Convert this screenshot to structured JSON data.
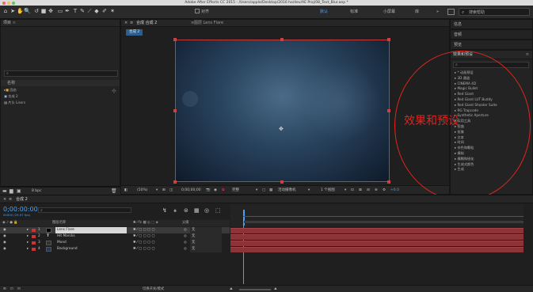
{
  "window": {
    "title": "Adobe After Effects CC 2015 - /Users/apple/Desktop/2016 ho/dev/AE Proj/08_Text_Blur.aep *"
  },
  "toolbar": {
    "align_label": "对齐",
    "workspaces": [
      "默认",
      "标准",
      "小屏幕",
      "库"
    ],
    "search_placeholder": "搜索帮助"
  },
  "project": {
    "panel_title": "项目",
    "search_placeholder": "",
    "col_name": "名称",
    "items": [
      {
        "icon": "folder-icon",
        "label": "固态"
      },
      {
        "icon": "comp-icon",
        "label": "合成 2"
      },
      {
        "icon": "text-icon",
        "label": "片头 Lisers"
      }
    ],
    "bpc": "8 bpc"
  },
  "comp_viewer": {
    "tab_comp": "合成 合成 2",
    "tab_layer": "图层 Lens Flare",
    "breadcrumb": "合成 2",
    "zoom": "(50%)",
    "timecode": "0;00;00;00",
    "quality": "完整",
    "camera": "活动摄像机",
    "views": "1 个视图",
    "exposure": "+0.0"
  },
  "right_panels": {
    "info": "信息",
    "audio": "音频",
    "preview": "预览",
    "effects_title": "效果和预设",
    "effects_search_placeholder": "",
    "effects": [
      "* 动画预设",
      "3D 通道",
      "CINEMA 4D",
      "Magic Bullet",
      "Red Giant",
      "Red Giant LUT Buddy",
      "Red Giant Shooter Suite",
      "RG Trapcode",
      "Synthetic Aperture",
      "实用工具",
      "扭曲",
      "抠像",
      "文本",
      "时间",
      "杂色和颗粒",
      "模拟",
      "模糊和锐化",
      "生成式颜色",
      "生成"
    ]
  },
  "annotation": {
    "text": "效果和预设"
  },
  "timeline": {
    "tab": "合成 2",
    "timecode": "0;00:00:00",
    "fps": "00000 (29.97 fps)",
    "col_name": "图层名称",
    "col_parent": "父级",
    "layers": [
      {
        "num": "1",
        "name": "Lens Flare",
        "parent": "无",
        "color": "#c2393a"
      },
      {
        "num": "2",
        "name": "Hit Marcks",
        "parent": "无",
        "color": "#c2393a"
      },
      {
        "num": "3",
        "name": "Mond",
        "parent": "无",
        "color": "#c2393a"
      },
      {
        "num": "4",
        "name": "Background",
        "parent": "无",
        "color": "#c2393a"
      }
    ],
    "toggle_label": "切换开关/模式"
  },
  "colors": {
    "accent": "#2d8ceb",
    "layer_bar": "#8a3438",
    "annotation": "#e0251f"
  }
}
